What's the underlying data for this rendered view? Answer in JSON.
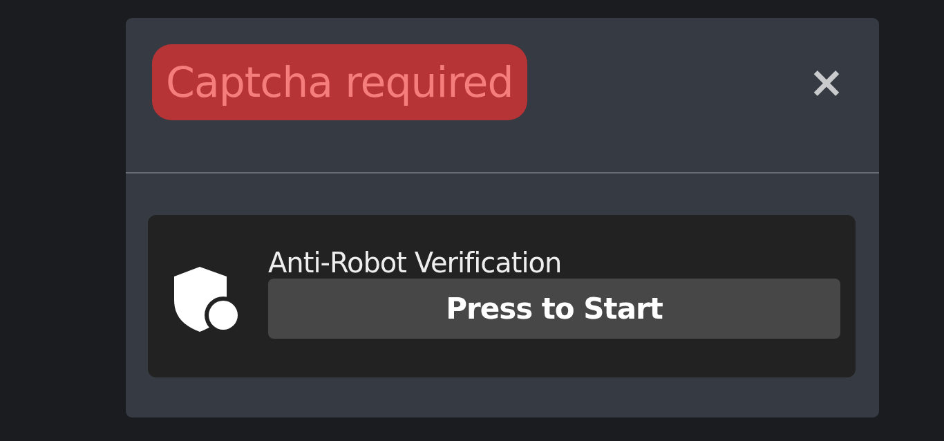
{
  "dialog": {
    "title": "Captcha required",
    "close": "×"
  },
  "captcha": {
    "title": "Anti-Robot Verification",
    "button": "Press to Start"
  }
}
